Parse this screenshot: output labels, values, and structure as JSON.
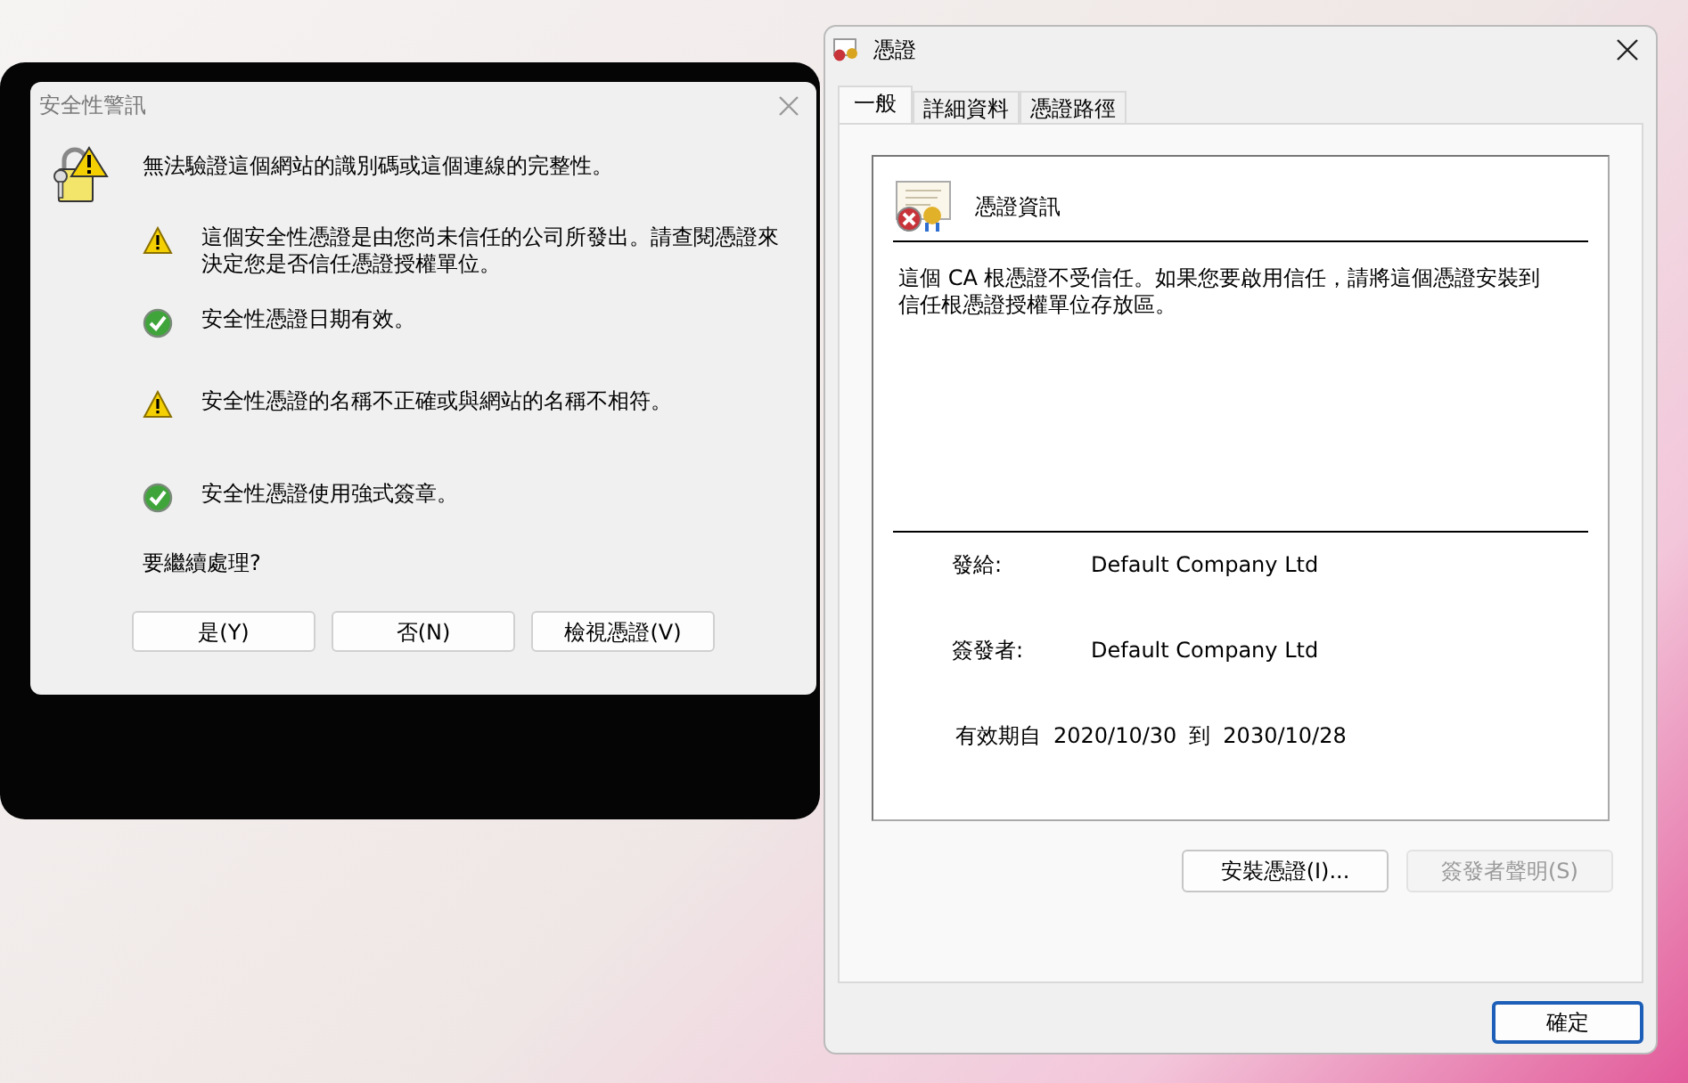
{
  "security_alert": {
    "title": "安全性警訊",
    "headline": "無法驗證這個網站的識別碼或這個連線的完整性。",
    "items": [
      {
        "kind": "warning",
        "text": "這個安全性憑證是由您尚未信任的公司所發出。請查閱憑證來決定您是否信任憑證授權單位。"
      },
      {
        "kind": "ok",
        "text": "安全性憑證日期有效。"
      },
      {
        "kind": "warning",
        "text": "安全性憑證的名稱不正確或與網站的名稱不相符。"
      },
      {
        "kind": "ok",
        "text": "安全性憑證使用強式簽章。"
      }
    ],
    "question": "要繼續處理?",
    "buttons": [
      "是(Y)",
      "否(N)",
      "檢視憑證(V)"
    ]
  },
  "certificate": {
    "title": "憑證",
    "tabs": [
      {
        "label": "一般",
        "selected": true
      },
      {
        "label": "詳細資料",
        "selected": false
      },
      {
        "label": "憑證路徑",
        "selected": false
      }
    ],
    "heading": "憑證資訊",
    "description": "這個 CA 根憑證不受信任。如果您要啟用信任，請將這個憑證安裝到信任根憑證授權單位存放區。",
    "fields": [
      {
        "label": "發給:",
        "value": "Default Company Ltd"
      },
      {
        "label": "簽發者:",
        "value": "Default Company Ltd"
      }
    ],
    "validity": {
      "label": "有效期自",
      "from": "2020/10/30",
      "to_label": "到",
      "to": "2030/10/28"
    },
    "buttons": [
      {
        "label": "安裝憑證(I)...",
        "disabled": false
      },
      {
        "label": "簽發者聲明(S)",
        "disabled": true
      }
    ],
    "ok_button": {
      "label": "確定",
      "default": true
    }
  }
}
